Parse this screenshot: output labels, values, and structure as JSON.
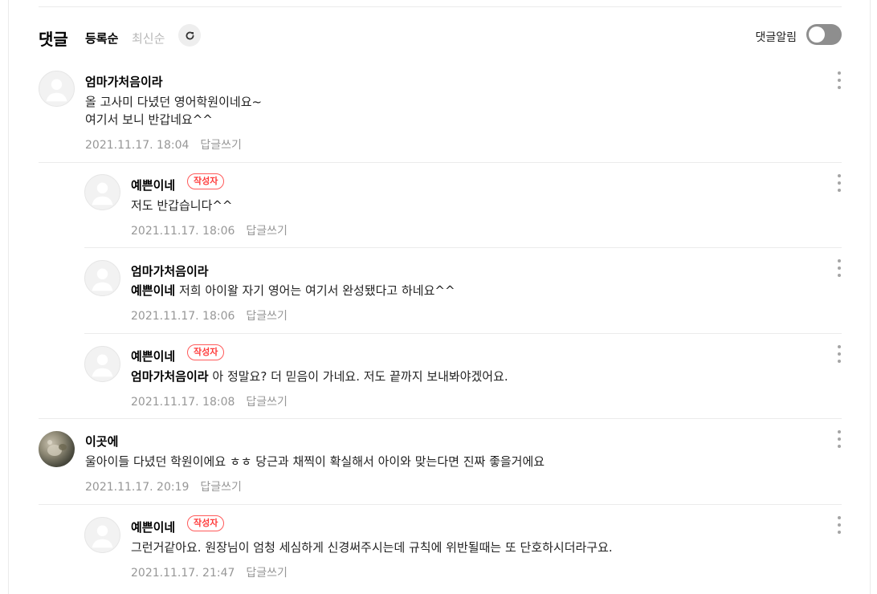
{
  "header": {
    "title": "댓글",
    "sort_registered": "등록순",
    "sort_latest": "최신순",
    "refresh_icon": "refresh-icon",
    "notify_label": "댓글알림",
    "notify_enabled": false
  },
  "comments": [
    {
      "nickname": "엄마가처음이라",
      "line1": "올 고사미 다녔던 영어학원이네요~",
      "line2": "여기서 보니 반갑네요^^",
      "date": "2021.11.17. 18:04",
      "reply": "답글쓰기"
    },
    {
      "nickname": "예쁜이네",
      "badge": "작성자",
      "text": "저도 반갑습니다^^",
      "date": "2021.11.17. 18:06",
      "reply": "답글쓰기"
    },
    {
      "nickname": "엄마가처음이라",
      "mention": "예쁜이네",
      "text": " 저희 아이왈 자기 영어는 여기서 완성됐다고 하네요^^",
      "date": "2021.11.17. 18:06",
      "reply": "답글쓰기"
    },
    {
      "nickname": "예쁜이네",
      "badge": "작성자",
      "mention": "엄마가처음이라",
      "text": " 아 정말요? 더 믿음이 가네요. 저도 끝까지 보내봐야겠어요.",
      "date": "2021.11.17. 18:08",
      "reply": "답글쓰기"
    },
    {
      "nickname": "이곳에",
      "text": "울아이들 다녔던 학원이에요 ㅎㅎ 당근과 채찍이 확실해서 아이와 맞는다면 진짜 좋을거에요",
      "date": "2021.11.17. 20:19",
      "reply": "답글쓰기"
    },
    {
      "nickname": "예쁜이네",
      "badge": "작성자",
      "text": "그런거같아요. 원장님이 엄청 세심하게 신경써주시는데 규칙에 위반될때는 또 단호하시더라구요.",
      "date": "2021.11.17. 21:47",
      "reply": "답글쓰기"
    }
  ]
}
